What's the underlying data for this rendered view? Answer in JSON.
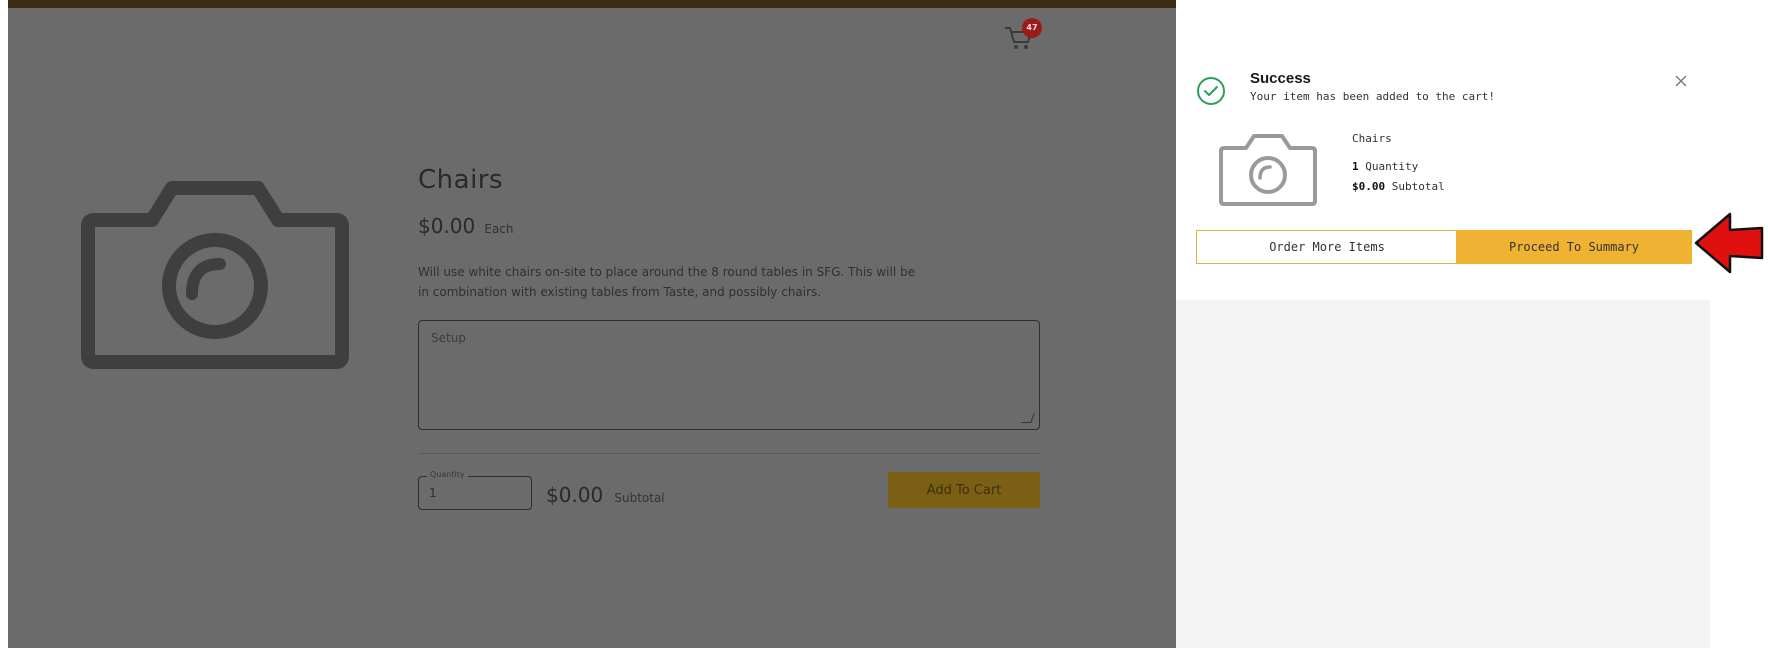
{
  "header": {
    "cart_count": "47"
  },
  "product": {
    "title": "Chairs",
    "price": "$0.00",
    "price_unit": "Each",
    "description_line1": "Will use white chairs on-site to place around the 8 round tables in SFG. This will be",
    "description_line2": "in combination with existing tables from Taste, and possibly chairs.",
    "setup_placeholder": "Setup",
    "quantity_label": "Quantity",
    "quantity_value": "1",
    "subtotal_value": "$0.00",
    "subtotal_label": "Subtotal",
    "add_to_cart_label": "Add To Cart"
  },
  "toast": {
    "title": "Success",
    "message": "Your item has been added to the cart!",
    "item_name": "Chairs",
    "item_quantity": "1",
    "item_quantity_label": "Quantity",
    "item_subtotal": "$0.00",
    "item_subtotal_label": "Subtotal",
    "order_more_label": "Order More Items",
    "proceed_label": "Proceed To Summary"
  },
  "icons": {
    "cart": "cart-icon",
    "camera": "camera-icon",
    "success": "check-circle-icon",
    "close": "close-icon",
    "arrow": "red-arrow-icon"
  },
  "colors": {
    "overlay": "#6b6b6b",
    "accent": "#f0b232",
    "success": "#2e9e5b",
    "annotation_arrow": "#e01010"
  }
}
